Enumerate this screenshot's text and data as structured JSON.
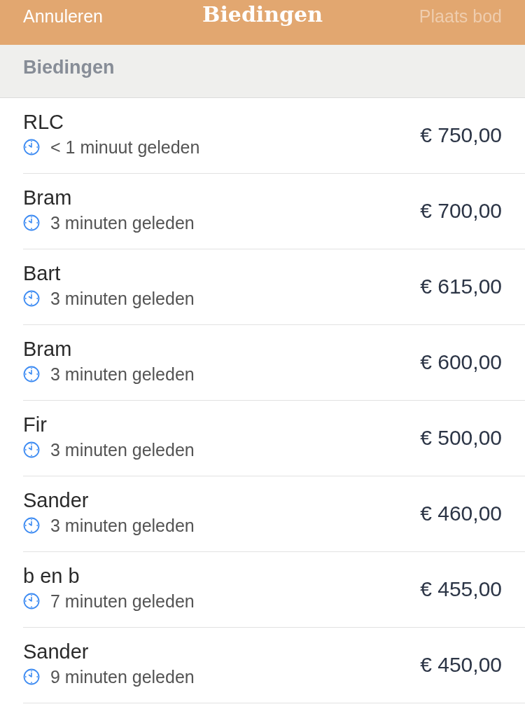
{
  "nav_bar": {
    "cancel": {
      "label": "Annuleren",
      "disabled": false
    },
    "title": "Biedingen",
    "place_bid": {
      "label": "Plaats bod",
      "disabled": true
    }
  },
  "section": {
    "title": "Biedingen"
  },
  "bids": [
    {
      "name": "RLC",
      "time": "< 1 minuut geleden",
      "amount": "€ 750,00"
    },
    {
      "name": "Bram",
      "time": "3 minuten geleden",
      "amount": "€ 700,00"
    },
    {
      "name": "Bart",
      "time": "3 minuten geleden",
      "amount": "€ 615,00"
    },
    {
      "name": "Bram",
      "time": "3 minuten geleden",
      "amount": "€ 600,00"
    },
    {
      "name": "Fir",
      "time": "3 minuten geleden",
      "amount": "€ 500,00"
    },
    {
      "name": "Sander",
      "time": "3 minuten geleden",
      "amount": "€ 460,00"
    },
    {
      "name": "b en b",
      "time": "7 minuten geleden",
      "amount": "€ 455,00"
    },
    {
      "name": "Sander",
      "time": "9 minuten geleden",
      "amount": "€ 450,00"
    }
  ]
}
